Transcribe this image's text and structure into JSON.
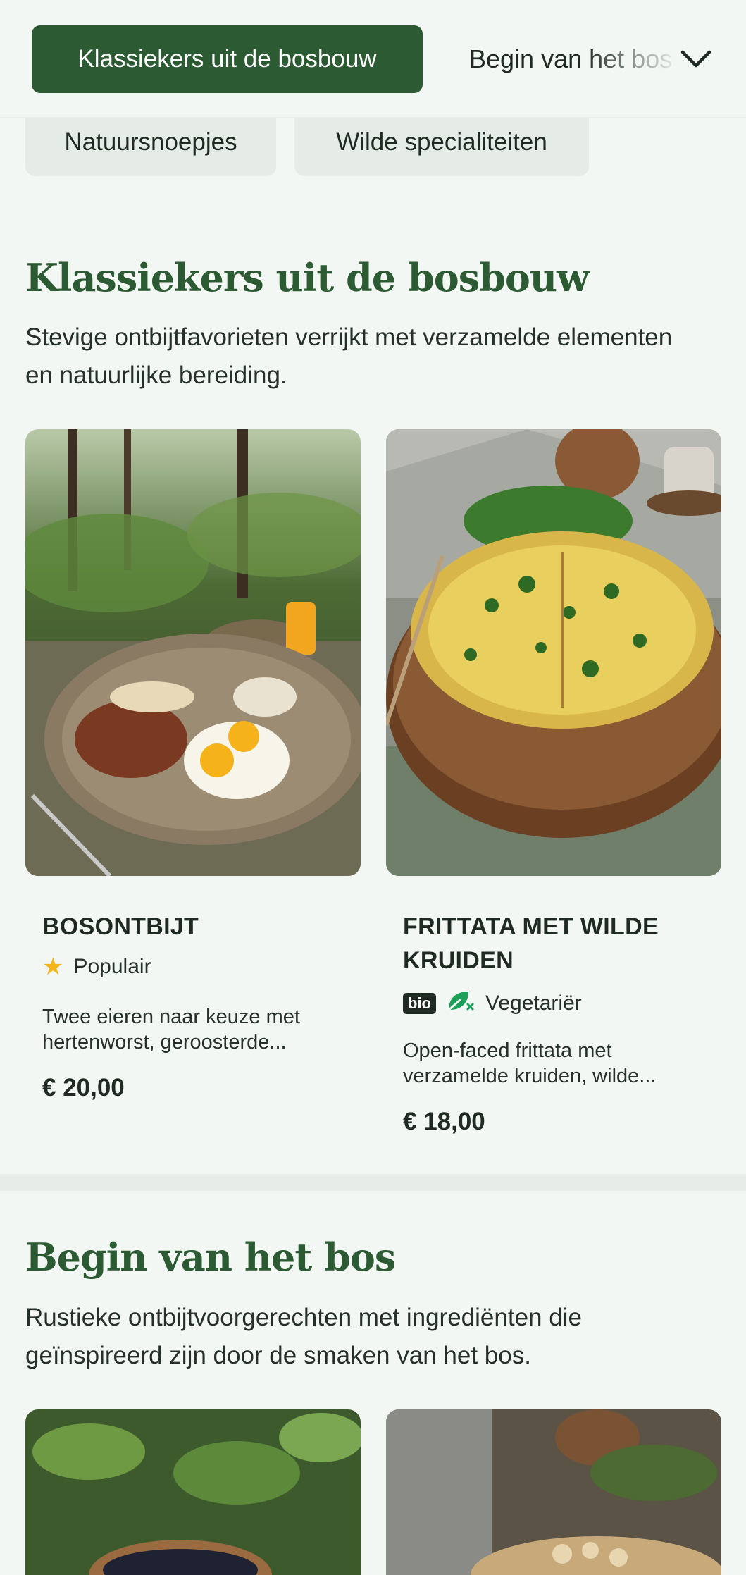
{
  "categories": {
    "active_label": "Klassiekers uit de bosbouw",
    "next_label": "Begin van het bos",
    "pills": [
      "Natuursnoepjes",
      "Wilde specialiteiten"
    ]
  },
  "sections": [
    {
      "title": "Klassiekers uit de bosbouw",
      "description": "Stevige ontbijtfavorieten verrijkt met verzamelde elementen en natuurlijke bereiding.",
      "items": [
        {
          "name": "BOSONTBIJT",
          "badge": "Populair",
          "description_line1": "Twee eieren naar keuze met",
          "description_line2": "hertenworst, geroosterde...",
          "price": "€ 20,00"
        },
        {
          "name_line1": "FRITTATA MET WILDE",
          "name_line2": "KRUIDEN",
          "bio_label": "bio",
          "badge": "Vegetariër",
          "description_line1": "Open-faced frittata met",
          "description_line2": "verzamelde kruiden, wilde...",
          "price": "€ 18,00"
        }
      ]
    },
    {
      "title": "Begin van het bos",
      "description": "Rustieke ontbijtvoorgerechten met ingrediënten die geïnspireerd zijn door de smaken van het bos."
    }
  ],
  "icons": {
    "chevron": "chevron-down-icon",
    "star": "star-icon",
    "vegetarian": "leaf-icon"
  },
  "colors": {
    "accent": "#2c5b33",
    "background": "#f2f7f3",
    "star": "#f2b51b",
    "vegetarian": "#1ba05a"
  }
}
